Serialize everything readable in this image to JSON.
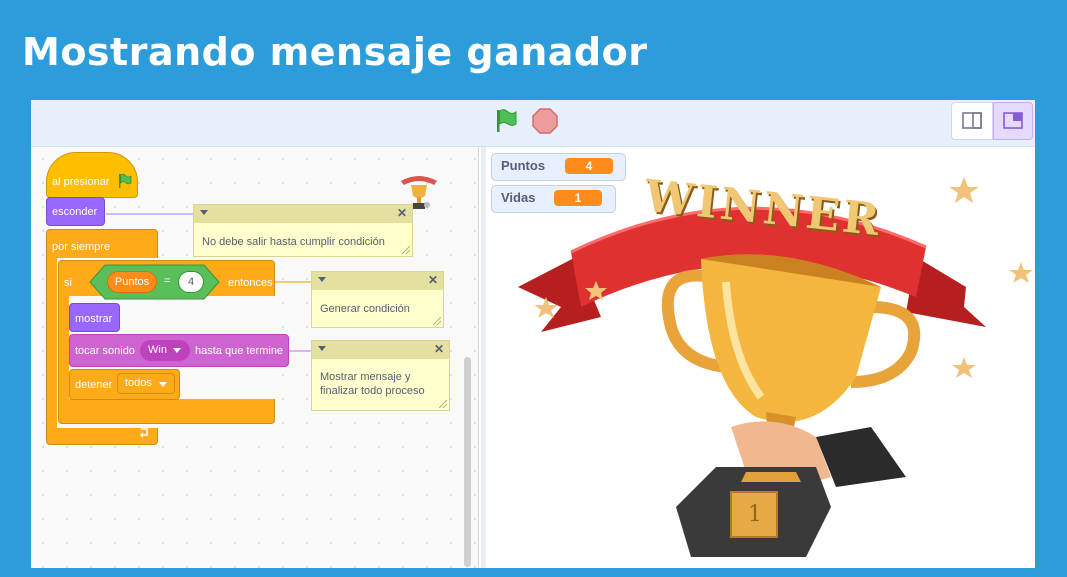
{
  "slide": {
    "title": "Mostrando mensaje ganador"
  },
  "toolbar": {
    "green_flag_icon": "green-flag-icon",
    "stop_icon": "stop-sign-icon",
    "small_stage_icon": "small-stage-icon",
    "large_stage_icon": "large-stage-icon"
  },
  "script": {
    "when_flag": "al presionar",
    "hide": "esconder",
    "forever": "por siempre",
    "if": "si",
    "variable": "Puntos",
    "equals": "=",
    "compare_value": "4",
    "then": "entonces",
    "show": "mostrar",
    "play_sound": "tocar sonido",
    "sound_name": "Win",
    "until_done": "hasta que termine",
    "stop": "detener",
    "stop_option": "todos"
  },
  "comments": [
    {
      "text": "No debe salir  hasta  cumplir condición"
    },
    {
      "text": "Generar condición"
    },
    {
      "line1": "Mostrar mensaje y",
      "line2": "finalizar  todo  proceso"
    }
  ],
  "monitors": [
    {
      "label": "Puntos",
      "value": "4"
    },
    {
      "label": "Vidas",
      "value": "1"
    }
  ],
  "stage": {
    "banner_text": "WINNER",
    "plaque_text": "1"
  },
  "colors": {
    "background": "#2d9cdb",
    "event": "#ffbf00",
    "looks": "#9966ff",
    "control": "#ffab19",
    "sound": "#cf63cf",
    "operator": "#59c059",
    "variable": "#ff8c1a"
  }
}
